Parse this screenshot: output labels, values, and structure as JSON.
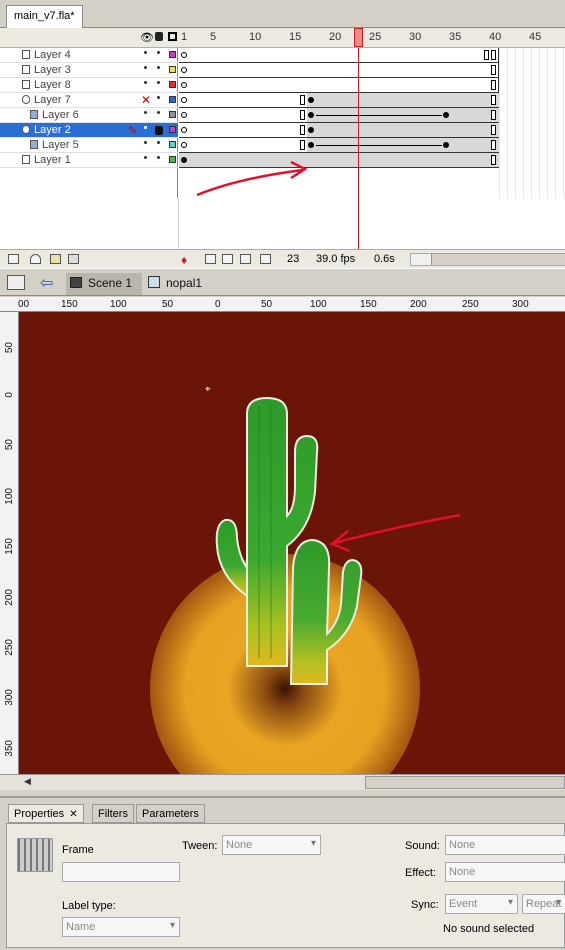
{
  "document": {
    "tab_title": "main_v7.fla*"
  },
  "timeline": {
    "frame_numbers": [
      "1",
      "5",
      "10",
      "15",
      "20",
      "25",
      "30",
      "35",
      "40",
      "45"
    ],
    "layers": [
      {
        "name": "Layer 4",
        "color": "#c040c0"
      },
      {
        "name": "Layer 3",
        "color": "#f0e040"
      },
      {
        "name": "Layer 8",
        "color": "#e03030"
      },
      {
        "name": "Layer 7",
        "color": "#3060e0"
      },
      {
        "name": "Layer 6",
        "color": "#909090"
      },
      {
        "name": "Layer 2",
        "color": "#c040c0"
      },
      {
        "name": "Layer 5",
        "color": "#60d0d0"
      },
      {
        "name": "Layer 1",
        "color": "#40c040"
      }
    ],
    "current_frame": "23",
    "fps": "39.0 fps",
    "elapsed": "0.6s"
  },
  "editbar": {
    "scene": "Scene 1",
    "symbol": "nopal1"
  },
  "rulers": {
    "top": [
      "00",
      "150",
      "100",
      "50",
      "0",
      "50",
      "100",
      "150",
      "200",
      "250",
      "300"
    ],
    "left": [
      "50",
      "0",
      "50",
      "100",
      "150",
      "200",
      "250",
      "300",
      "350"
    ]
  },
  "properties": {
    "tabs": [
      "Properties",
      "Filters",
      "Parameters"
    ],
    "frame_label": "Frame",
    "tween_label": "Tween:",
    "tween_value": "None",
    "label_type_label": "Label type:",
    "label_type_value": "Name",
    "sound_label": "Sound:",
    "sound_value": "None",
    "effect_label": "Effect:",
    "effect_value": "None",
    "sync_label": "Sync:",
    "sync_value": "Event",
    "repeat_value": "Repeat",
    "no_sound": "No sound selected"
  },
  "colors": {
    "stage": "#6b1408",
    "annotation": "#e0102a",
    "selection": "#2a6fd6"
  }
}
